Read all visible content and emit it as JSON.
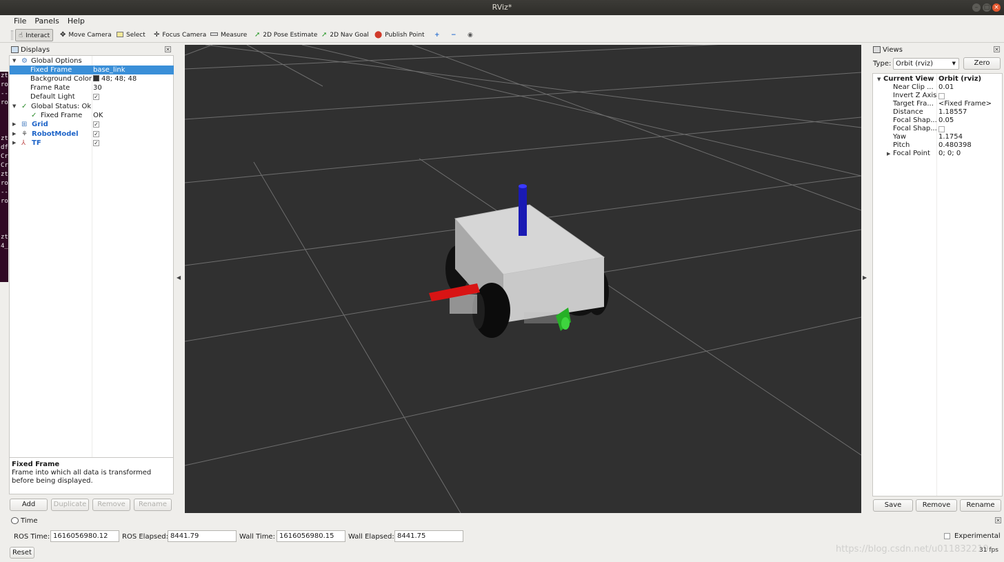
{
  "window": {
    "title": "RViz*"
  },
  "menu": {
    "file": "File",
    "panels": "Panels",
    "help": "Help"
  },
  "toolbar": {
    "interact": "Interact",
    "move_camera": "Move Camera",
    "select": "Select",
    "focus_camera": "Focus Camera",
    "measure": "Measure",
    "pose_estimate": "2D Pose Estimate",
    "nav_goal": "2D Nav Goal",
    "publish_point": "Publish Point",
    "active_tool": "Interact"
  },
  "displays": {
    "title": "Displays",
    "global_options": "Global Options",
    "fixed_frame_label": "Fixed Frame",
    "fixed_frame_value": "base_link",
    "bg_color_label": "Background Color",
    "bg_color_value": "48; 48; 48",
    "frame_rate_label": "Frame Rate",
    "frame_rate_value": "30",
    "default_light_label": "Default Light",
    "global_status": "Global Status: Ok",
    "status_fixed_frame": "Fixed Frame",
    "status_fixed_frame_value": "OK",
    "grid": "Grid",
    "robot_model": "RobotModel",
    "tf": "TF",
    "help_title": "Fixed Frame",
    "help_text": "Frame into which all data is transformed before being displayed.",
    "buttons": {
      "add": "Add",
      "duplicate": "Duplicate",
      "remove": "Remove",
      "rename": "Rename"
    }
  },
  "views": {
    "title": "Views",
    "type_label": "Type:",
    "type_value": "Orbit (rviz)",
    "zero": "Zero",
    "current_view": "Current View",
    "current_view_value": "Orbit (rviz)",
    "near_clip_label": "Near Clip ...",
    "near_clip_value": "0.01",
    "invert_z_label": "Invert Z Axis",
    "target_frame_label": "Target Fra...",
    "target_frame_value": "<Fixed Frame>",
    "distance_label": "Distance",
    "distance_value": "1.18557",
    "focal_shape_size_label": "Focal Shap...",
    "focal_shape_size_value": "0.05",
    "focal_shape_fixed_label": "Focal Shap...",
    "yaw_label": "Yaw",
    "yaw_value": "1.1754",
    "pitch_label": "Pitch",
    "pitch_value": "0.480398",
    "focal_point_label": "Focal Point",
    "focal_point_value": "0; 0; 0",
    "buttons": {
      "save": "Save",
      "remove": "Remove",
      "rename": "Rename"
    }
  },
  "time": {
    "title": "Time",
    "ros_time_label": "ROS Time:",
    "ros_time_value": "1616056980.12",
    "ros_elapsed_label": "ROS Elapsed:",
    "ros_elapsed_value": "8441.79",
    "wall_time_label": "Wall Time:",
    "wall_time_value": "1616056980.15",
    "wall_elapsed_label": "Wall Elapsed:",
    "wall_elapsed_value": "8441.75",
    "experimental": "Experimental",
    "reset": "Reset",
    "fps": "31 fps"
  },
  "watermark": "https://blog.csdn.net/u011832219",
  "colors": {
    "selection": "#3a8fd8",
    "viewport_bg": "#303030",
    "link_blue": "#1e64c8"
  }
}
